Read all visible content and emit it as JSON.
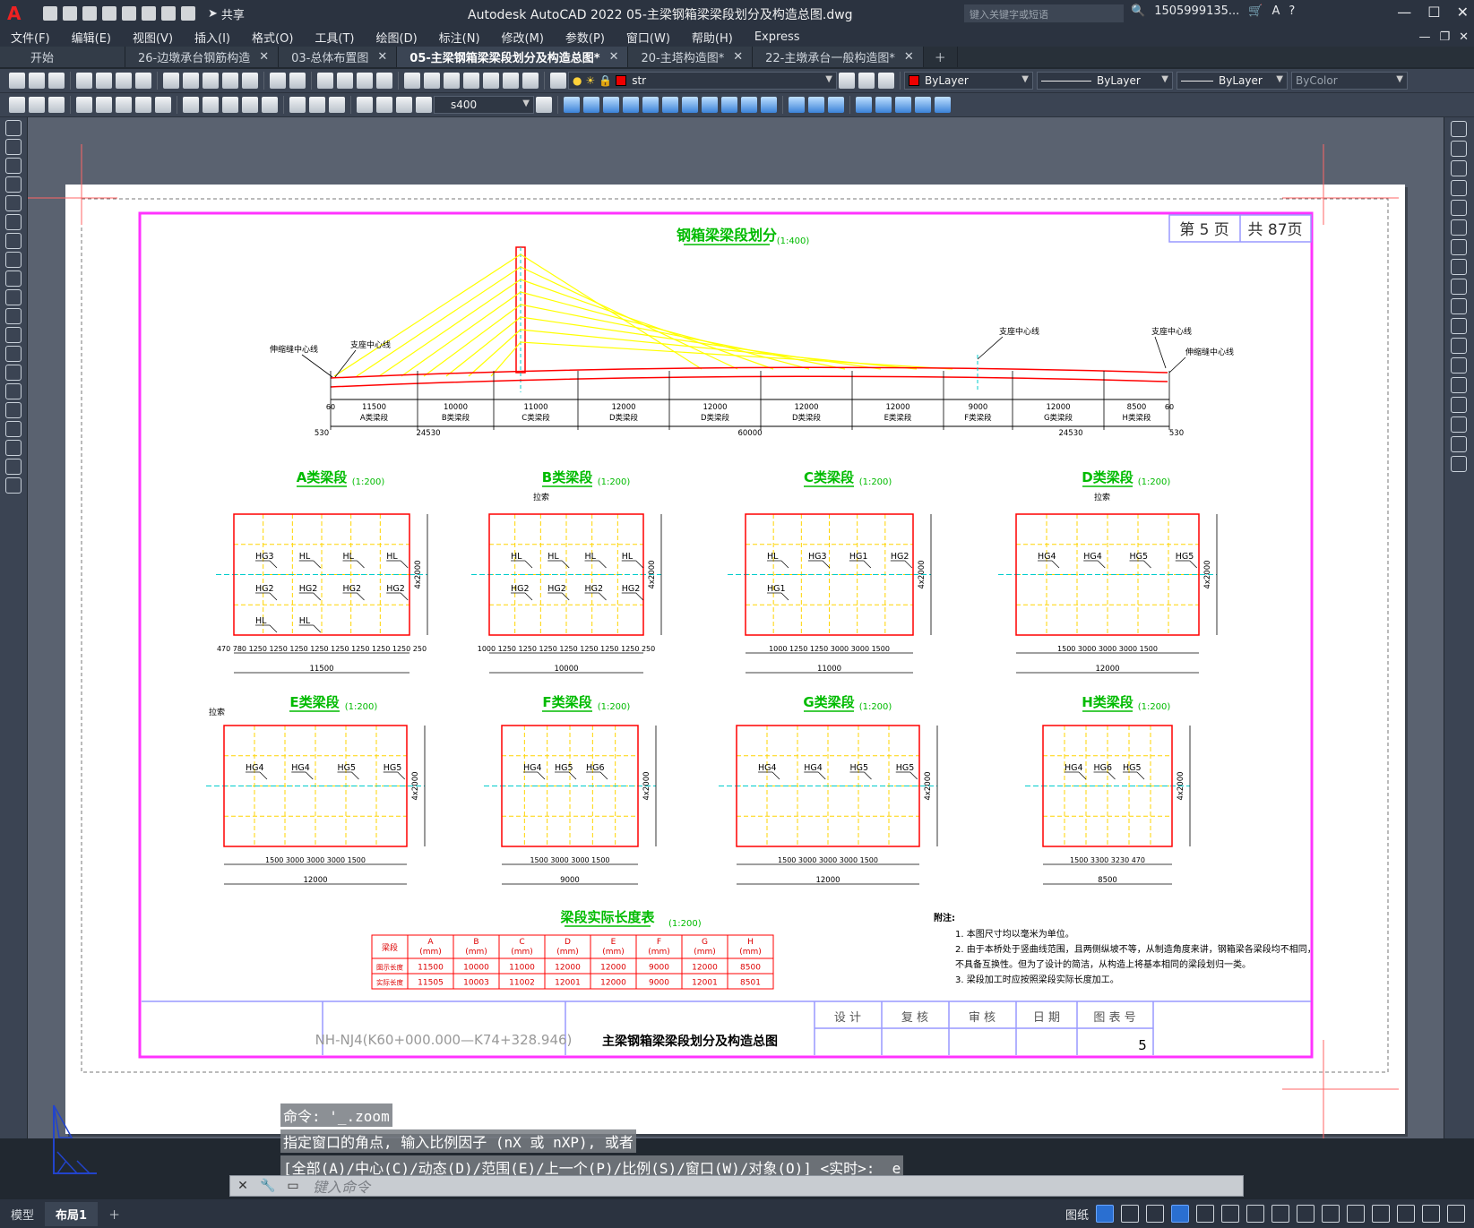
{
  "app": {
    "logo": "A",
    "title": "Autodesk AutoCAD 2022    05-主梁钢箱梁梁段划分及构造总图.dwg",
    "share_label": "共享",
    "search_placeholder": "键入关键字或短语",
    "user": "1505999135...",
    "help": "?"
  },
  "menu": [
    "文件(F)",
    "编辑(E)",
    "视图(V)",
    "插入(I)",
    "格式(O)",
    "工具(T)",
    "绘图(D)",
    "标注(N)",
    "修改(M)",
    "参数(P)",
    "窗口(W)",
    "帮助(H)",
    "Express"
  ],
  "tabs": [
    {
      "label": "开始",
      "closable": false,
      "active": false
    },
    {
      "label": "26-边墩承台钢筋构造",
      "closable": true,
      "active": false
    },
    {
      "label": "03-总体布置图",
      "closable": true,
      "active": false
    },
    {
      "label": "05-主梁钢箱梁梁段划分及构造总图*",
      "closable": true,
      "active": true
    },
    {
      "label": "20-主塔构造图*",
      "closable": true,
      "active": false
    },
    {
      "label": "22-主墩承台一般构造图*",
      "closable": true,
      "active": false
    }
  ],
  "toolbar": {
    "layer": "str",
    "color": "ByLayer",
    "linetype": "ByLayer",
    "lineweight": "ByLayer",
    "plotstyle": "ByColor",
    "dimstyle": "s400"
  },
  "drawing": {
    "page_no": "第 5 页",
    "page_total": "共 87页",
    "main_title": "钢箱梁梁段划分",
    "main_scale": "(1:400)",
    "label_left_joint": "伸缩缝中心线",
    "label_bearing": "支座中心线",
    "elev_dims": [
      "11500",
      "10000",
      "11000",
      "12000",
      "12000",
      "12000",
      "12000",
      "9000",
      "12000",
      "8500"
    ],
    "elev_segments": [
      "A类梁段",
      "B类梁段",
      "C类梁段",
      "D类梁段",
      "D类梁段",
      "D类梁段",
      "E类梁段",
      "F类梁段",
      "G类梁段",
      "H类梁段"
    ],
    "elev_totals": [
      "530",
      "24530",
      "60000",
      "24530",
      "530"
    ],
    "elev_small": [
      "60",
      "60"
    ],
    "segments": [
      {
        "name": "A类梁段",
        "scale": "(1:200)",
        "total": "11500",
        "dims": "470  780 1250 1250 1250 1250 1250 1250 1250 1250  250",
        "labels": [
          "HG3",
          "HL",
          "HL",
          "HL",
          "HG2",
          "HG2",
          "HG2",
          "HG2",
          "HL",
          "HL"
        ],
        "side": "4x2000"
      },
      {
        "name": "B类梁段",
        "scale": "(1:200)",
        "total": "10000",
        "dims": "1000 1250 1250 1250 1250 1250 1250 1250  250",
        "labels": [
          "HL",
          "HL",
          "HL",
          "HL",
          "HG2",
          "HG2",
          "HG2",
          "HG2"
        ],
        "side": "4x2000"
      },
      {
        "name": "C类梁段",
        "scale": "(1:200)",
        "total": "11000",
        "dims": "1000 1250 1250   3000   3000  1500",
        "labels": [
          "HL",
          "HG3",
          "HG1",
          "HG2",
          "HG1"
        ],
        "side": "4x2000"
      },
      {
        "name": "D类梁段",
        "scale": "(1:200)",
        "total": "12000",
        "dims": "1500  3000  3000  3000  1500",
        "labels": [
          "HG4",
          "HG4",
          "HG5",
          "HG5"
        ],
        "side": "4x2000"
      },
      {
        "name": "E类梁段",
        "scale": "(1:200)",
        "total": "12000",
        "dims": "1500  3000  3000  3000  1500",
        "labels": [
          "HG4",
          "HG4",
          "HG5",
          "HG5"
        ],
        "side": "4x2000"
      },
      {
        "name": "F类梁段",
        "scale": "(1:200)",
        "total": "9000",
        "dims": "1500  3000  3000  1500",
        "labels": [
          "HG4",
          "HG5",
          "HG6"
        ],
        "side": "4x2000"
      },
      {
        "name": "G类梁段",
        "scale": "(1:200)",
        "total": "12000",
        "dims": "1500  3000  3000  3000  1500",
        "labels": [
          "HG4",
          "HG4",
          "HG5",
          "HG5"
        ],
        "side": "4x2000"
      },
      {
        "name": "H类梁段",
        "scale": "(1:200)",
        "total": "8500",
        "dims": "1500  3300  3230  470",
        "labels": [
          "HG4",
          "HG6",
          "HG5"
        ],
        "side": "4x2000"
      }
    ],
    "cable_label": "拉索",
    "table": {
      "title": "梁段实际长度表",
      "scale": "(1:200)",
      "header": [
        "梁段",
        "A\n(mm)",
        "B\n(mm)",
        "C\n(mm)",
        "D\n(mm)",
        "E\n(mm)",
        "F\n(mm)",
        "G\n(mm)",
        "H\n(mm)"
      ],
      "rows": [
        [
          "图示长度",
          "11500",
          "10000",
          "11000",
          "12000",
          "12000",
          "9000",
          "12000",
          "8500"
        ],
        [
          "实际长度",
          "11505",
          "10003",
          "11002",
          "12001",
          "12000",
          "9000",
          "12001",
          "8501"
        ]
      ]
    },
    "notes": {
      "title": "附注:",
      "items": [
        "1. 本图尺寸均以毫米为单位。",
        "2. 由于本桥处于竖曲线范围，且两侧纵坡不等，从制造角度来讲，钢箱梁各梁段均不相同，",
        "   不具备互换性。但为了设计的简洁，从构造上将基本相同的梁段划归一类。",
        "3. 梁段加工时应按照梁段实际长度加工。"
      ]
    },
    "titleblock": {
      "project": "NH-NJ4(K60+000.000—K74+328.946)",
      "drawing_name": "主梁钢箱梁梁段划分及构造总图",
      "headers": [
        "设 计",
        "复 核",
        "审 核",
        "日 期",
        "图 表 号"
      ],
      "sheet_no": "5"
    }
  },
  "command": {
    "history": [
      "命令: '_.zoom",
      "指定窗口的角点, 输入比例因子 (nX 或 nXP), 或者",
      "[全部(A)/中心(C)/动态(D)/范围(E)/上一个(P)/比例(S)/窗口(W)/对象(O)] <实时>: _e"
    ],
    "placeholder": "键入命令"
  },
  "status": {
    "layout_tabs": [
      "模型",
      "布局1"
    ],
    "paper_label": "图纸"
  },
  "colors": {
    "accent": "#2a6fd1",
    "magenta": "#ff33ff",
    "red": "#ff0000",
    "yellow": "#ffff00",
    "green": "#00cc00",
    "cyan": "#00ffff"
  }
}
